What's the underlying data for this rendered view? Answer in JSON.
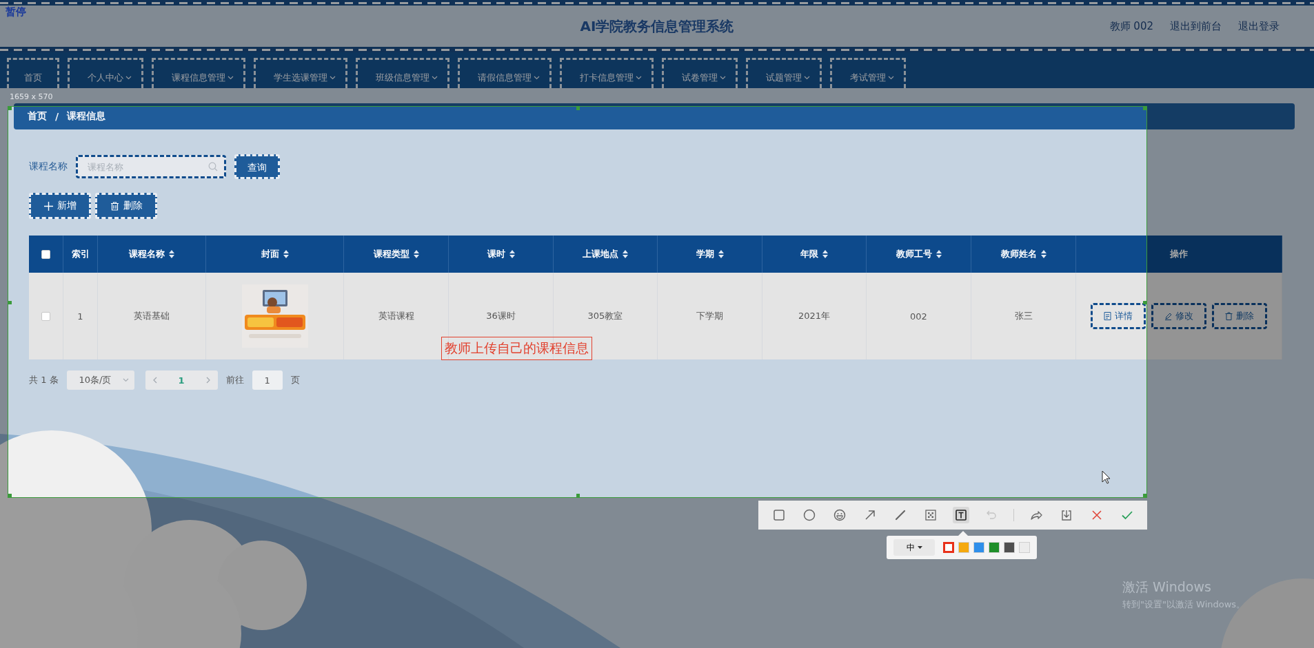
{
  "recorder_label": "暂停",
  "header": {
    "title": "AI学院教务信息管理系统",
    "links": [
      "教师 002",
      "退出到前台",
      "退出登录"
    ]
  },
  "nav": [
    {
      "label": "首页",
      "has_menu": false
    },
    {
      "label": "个人中心",
      "has_menu": true
    },
    {
      "label": "课程信息管理",
      "has_menu": true
    },
    {
      "label": "学生选课管理",
      "has_menu": true
    },
    {
      "label": "班级信息管理",
      "has_menu": true
    },
    {
      "label": "请假信息管理",
      "has_menu": true
    },
    {
      "label": "打卡信息管理",
      "has_menu": true
    },
    {
      "label": "试卷管理",
      "has_menu": true
    },
    {
      "label": "试题管理",
      "has_menu": true
    },
    {
      "label": "考试管理",
      "has_menu": true
    }
  ],
  "selection_size": "1659 x 570",
  "breadcrumb": {
    "items": [
      "首页",
      "课程信息"
    ],
    "separator": "/"
  },
  "search": {
    "label": "课程名称",
    "placeholder": "课程名称",
    "button": "查询"
  },
  "actions": [
    {
      "label": "新增",
      "kind": "add"
    },
    {
      "label": "删除",
      "kind": "delete"
    }
  ],
  "table": {
    "all_checked": false,
    "columns": [
      {
        "label": "索引",
        "sortable": false
      },
      {
        "label": "课程名称",
        "sortable": true
      },
      {
        "label": "封面",
        "sortable": true
      },
      {
        "label": "课程类型",
        "sortable": true
      },
      {
        "label": "课时",
        "sortable": true
      },
      {
        "label": "上课地点",
        "sortable": true
      },
      {
        "label": "学期",
        "sortable": true
      },
      {
        "label": "年限",
        "sortable": true
      },
      {
        "label": "教师工号",
        "sortable": true
      },
      {
        "label": "教师姓名",
        "sortable": true
      },
      {
        "label": "操作",
        "sortable": false
      }
    ],
    "rows": [
      {
        "checked": false,
        "cells": [
          {
            "kind": "text",
            "text": "1"
          },
          {
            "kind": "text",
            "text": "英语基础"
          },
          {
            "kind": "picture"
          },
          {
            "kind": "text",
            "text": "英语课程"
          },
          {
            "kind": "text",
            "text": "36课时"
          },
          {
            "kind": "text",
            "text": "305教室"
          },
          {
            "kind": "text",
            "text": "下学期"
          },
          {
            "kind": "text",
            "text": "2021年"
          },
          {
            "kind": "text",
            "text": "002"
          },
          {
            "kind": "text",
            "text": "张三"
          }
        ],
        "ops": [
          {
            "label": "详情",
            "kind": "detail"
          },
          {
            "label": "修改",
            "kind": "edit"
          },
          {
            "label": "删除",
            "kind": "delete"
          }
        ]
      }
    ]
  },
  "pagination": {
    "total": "共 1 条",
    "page_size": "10条/页",
    "pages": [
      {
        "label": "1",
        "selected": true
      }
    ],
    "goto_label": "前往",
    "goto_value": "1",
    "goto_suffix": "页"
  },
  "annotation": "教师上传自己的课程信息",
  "toolbar": {
    "tool_groups": [
      [
        {
          "kind": "rectangle",
          "selected": false,
          "disabled": false
        },
        {
          "kind": "circle",
          "selected": false,
          "disabled": false
        },
        {
          "kind": "emoji",
          "selected": false,
          "disabled": false
        },
        {
          "kind": "arrow",
          "selected": false,
          "disabled": false
        },
        {
          "kind": "pen",
          "selected": false,
          "disabled": false
        },
        {
          "kind": "mosaic",
          "selected": false,
          "disabled": false
        },
        {
          "kind": "text",
          "selected": true,
          "disabled": false
        },
        {
          "kind": "undo",
          "selected": false,
          "disabled": true
        }
      ],
      [
        {
          "kind": "share"
        },
        {
          "kind": "download"
        },
        {
          "kind": "close"
        },
        {
          "kind": "confirm"
        }
      ]
    ],
    "size": "中",
    "colors": [
      {
        "color": "#e8311a",
        "selected": true
      },
      {
        "color": "#f5a90f",
        "selected": false
      },
      {
        "color": "#2f8fea",
        "selected": false
      },
      {
        "color": "#1f8f2a",
        "selected": false
      },
      {
        "color": "#505050",
        "selected": false
      },
      {
        "color": "#ececec",
        "selected": false
      }
    ]
  },
  "os_notice": {
    "title": "激活 Windows",
    "subtitle": "转到\"设置\"以激活 Windows。"
  }
}
